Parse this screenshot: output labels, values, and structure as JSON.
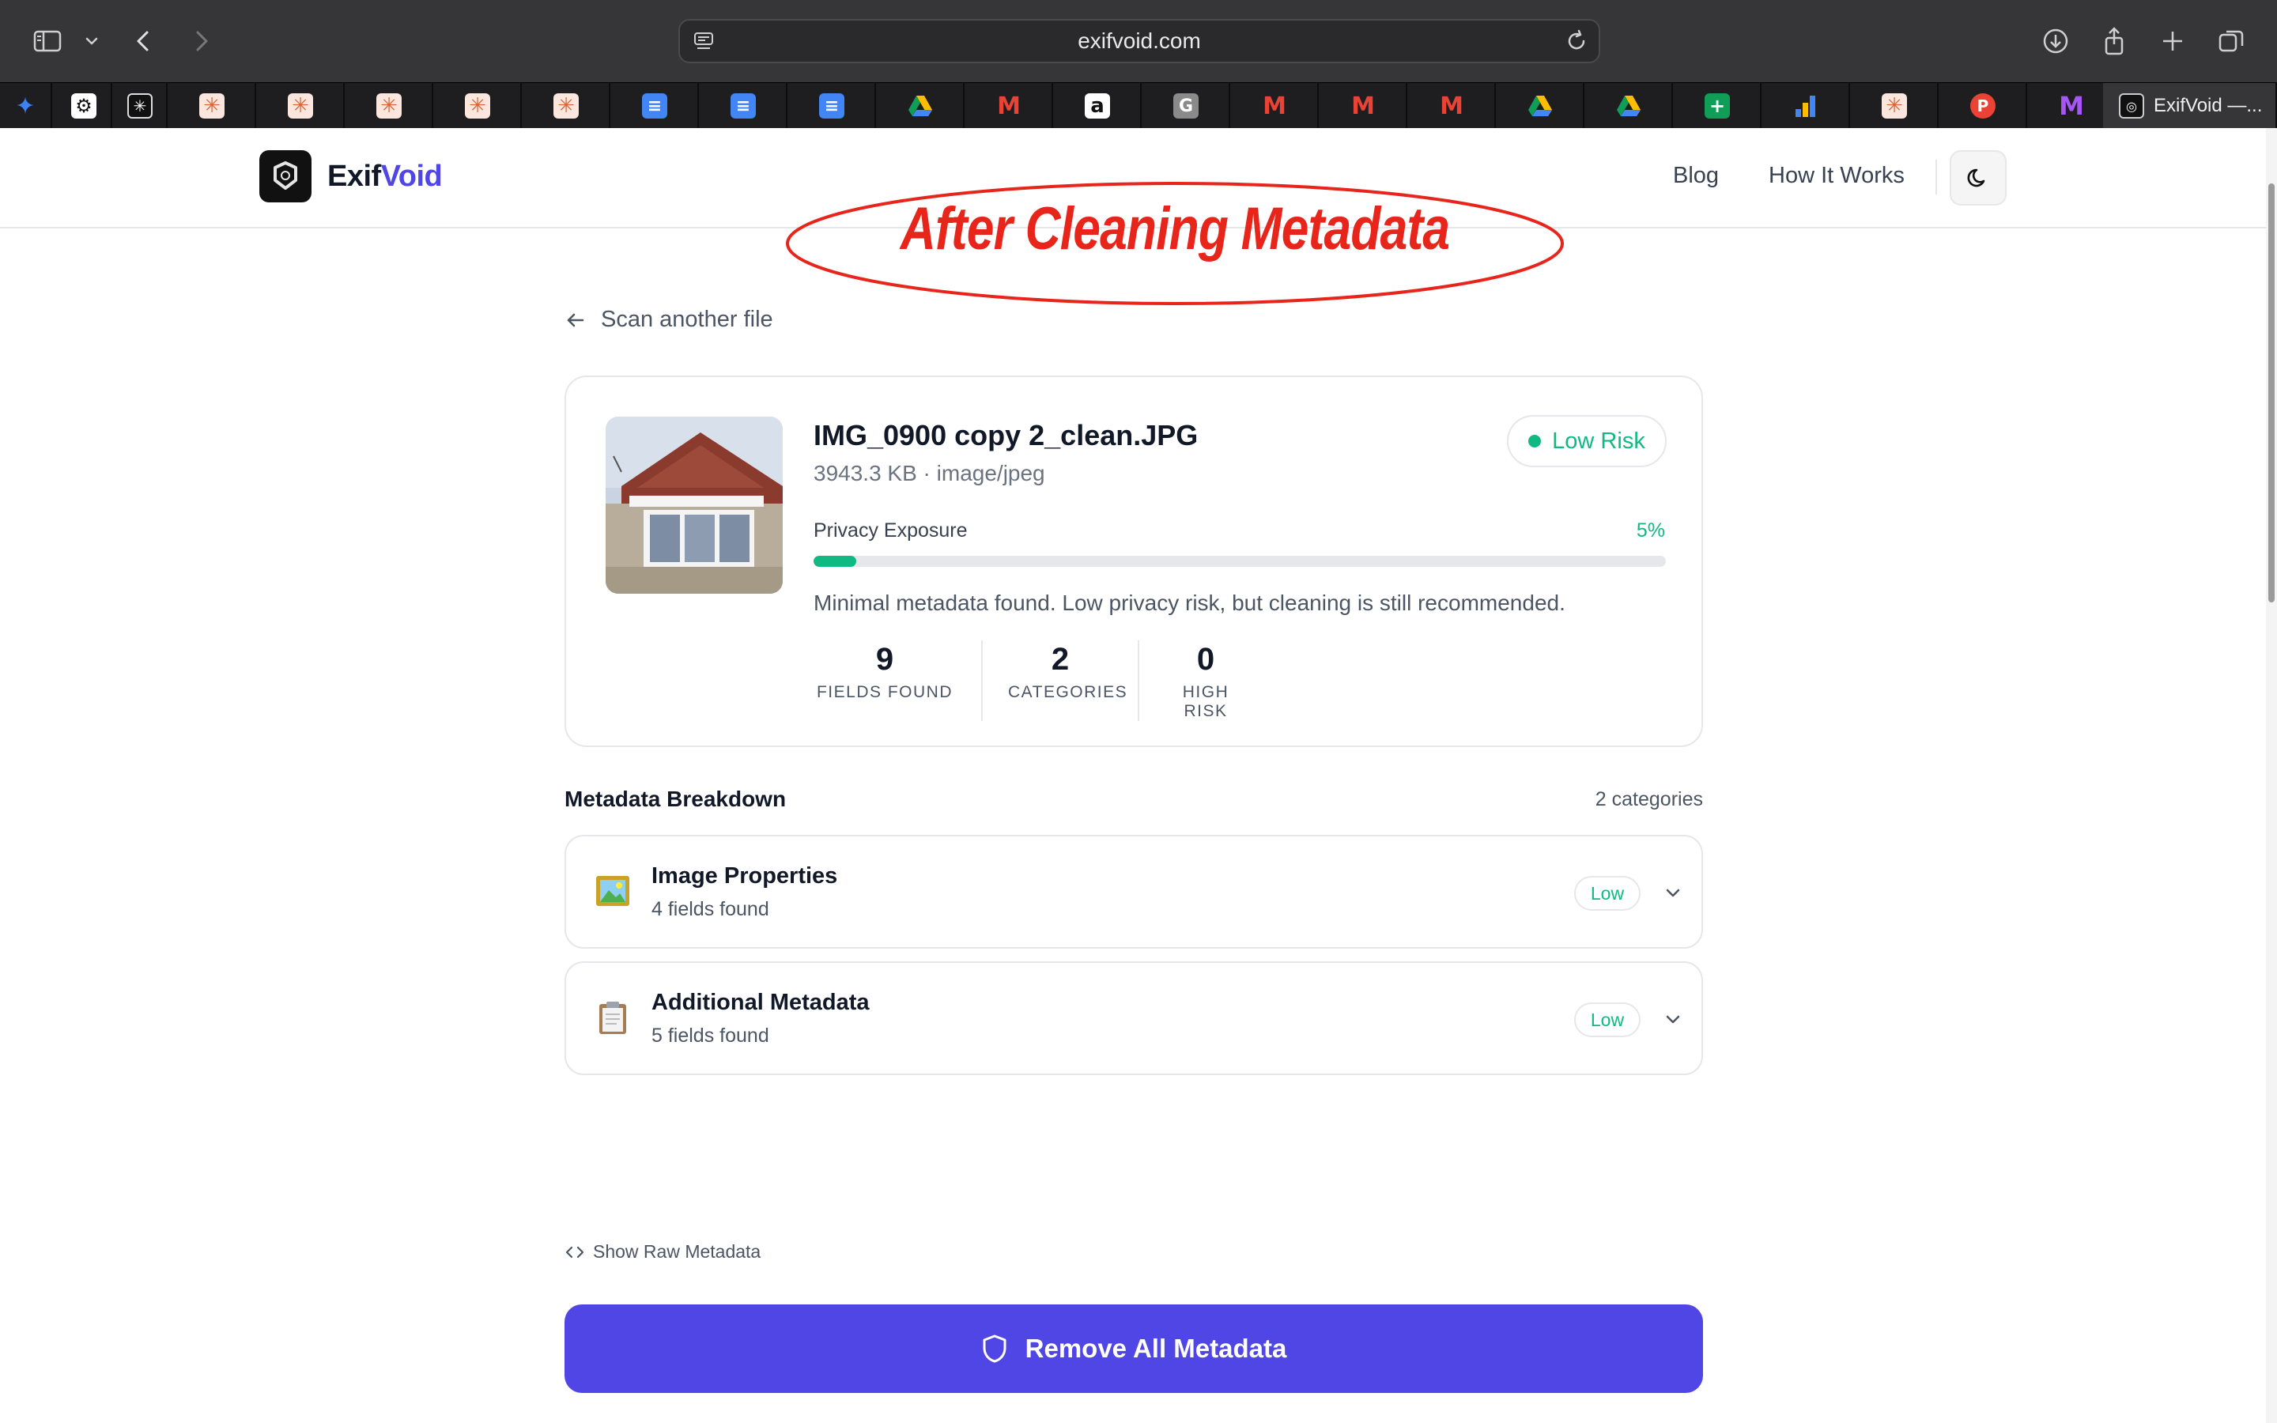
{
  "browser": {
    "url": "exifvoid.com",
    "active_tab_title": "ExifVoid —...",
    "favicons": [
      "sparkle-icon",
      "openai-icon",
      "perplexity-icon",
      "claude-icon",
      "claude-icon",
      "claude-icon",
      "claude-icon",
      "claude-icon",
      "docs-icon",
      "docs-icon",
      "docs-icon",
      "drive-icon",
      "gmail-icon",
      "amazon-icon",
      "grammarly-icon",
      "gmail-icon",
      "gmail-icon",
      "gmail-icon",
      "drive-icon",
      "drive-icon",
      "sheets-icon",
      "analytics-icon",
      "claude-icon",
      "producthunt-icon",
      "monday-icon"
    ]
  },
  "header": {
    "brand_part1": "Exif",
    "brand_part2": "Void",
    "nav_blog": "Blog",
    "nav_how": "How It Works"
  },
  "annotation": {
    "text": "After Cleaning Metadata",
    "color": "#e8251b"
  },
  "back_link": "Scan another file",
  "file": {
    "name": "IMG_0900 copy 2_clean.JPG",
    "meta": "3943.3 KB · image/jpeg",
    "risk_label": "Low Risk",
    "exposure_label": "Privacy Exposure",
    "exposure_pct_text": "5%",
    "exposure_fraction": 0.05,
    "description": "Minimal metadata found. Low privacy risk, but cleaning is still recommended."
  },
  "stats": [
    {
      "num": "9",
      "label": "FIELDS FOUND"
    },
    {
      "num": "2",
      "label": "CATEGORIES"
    },
    {
      "num": "0",
      "label": "HIGH RISK"
    }
  ],
  "breakdown": {
    "title": "Metadata Breakdown",
    "count": "2 categories",
    "categories": [
      {
        "name": "Image Properties",
        "sub": "4 fields found",
        "badge": "Low",
        "icon": "picture-icon"
      },
      {
        "name": "Additional Metadata",
        "sub": "5 fields found",
        "badge": "Low",
        "icon": "clipboard-icon"
      }
    ]
  },
  "raw_link": "Show Raw Metadata",
  "remove_button": "Remove All Metadata",
  "colors": {
    "accent": "#4f46e5",
    "success": "#10b981"
  }
}
